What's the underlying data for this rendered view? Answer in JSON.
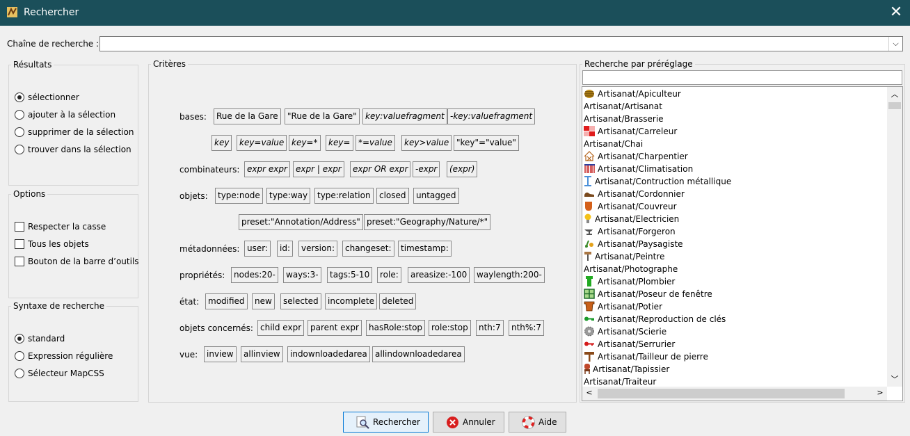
{
  "window": {
    "title": "Rechercher"
  },
  "search": {
    "label": "Chaîne de recherche :",
    "value": "",
    "placeholder": ""
  },
  "results": {
    "title": "Résultats",
    "options": [
      {
        "label": "sélectionner",
        "selected": true
      },
      {
        "label": "ajouter à la sélection",
        "selected": false
      },
      {
        "label": "supprimer de la sélection",
        "selected": false
      },
      {
        "label": "trouver dans la sélection",
        "selected": false
      }
    ]
  },
  "options": {
    "title": "Options",
    "checks": [
      {
        "label": "Respecter la casse",
        "checked": false
      },
      {
        "label": "Tous les objets",
        "checked": false
      },
      {
        "label": "Bouton de la barre d’outils",
        "checked": false
      }
    ]
  },
  "syntax": {
    "title": "Syntaxe de recherche",
    "options": [
      {
        "label": "standard",
        "selected": true
      },
      {
        "label": "Expression régulière",
        "selected": false
      },
      {
        "label": "Sélecteur MapCSS",
        "selected": false
      }
    ]
  },
  "criteria": {
    "title": "Critères",
    "rows": [
      {
        "label": "bases:",
        "tokens": [
          "Rue de la Gare",
          "\"Rue de la Gare\"",
          "key:valuefragment",
          "-key:valuefragment"
        ]
      },
      {
        "label": "",
        "tokens": [
          "key",
          "key=value",
          "key=*",
          "key=",
          "*=value",
          "key>value",
          "\"key\"=\"value\""
        ]
      },
      {
        "label": "combinateurs:",
        "tokens": [
          "expr expr",
          "expr | expr",
          "expr OR expr",
          "-expr",
          "(expr)"
        ]
      },
      {
        "label": "objets:",
        "tokens": [
          "type:node",
          "type:way",
          "type:relation",
          "closed",
          "untagged"
        ]
      },
      {
        "label": "",
        "tokens": [
          "preset:\"Annotation/Address\"",
          "preset:\"Geography/Nature/*\""
        ]
      },
      {
        "label": "métadonnées:",
        "tokens": [
          "user:",
          "id:",
          "version:",
          "changeset:",
          "timestamp:"
        ]
      },
      {
        "label": "propriétés:",
        "tokens": [
          "nodes:20-",
          "ways:3-",
          "tags:5-10",
          "role:",
          "areasize:-100",
          "waylength:200-"
        ]
      },
      {
        "label": "état:",
        "tokens": [
          "modified",
          "new",
          "selected",
          "incomplete",
          "deleted"
        ]
      },
      {
        "label": "objets concernés:",
        "tokens": [
          "child expr",
          "parent expr",
          "hasRole:stop",
          "role:stop",
          "nth:7",
          "nth%:7"
        ]
      },
      {
        "label": "vue:",
        "tokens": [
          "inview",
          "allinview",
          "indownloadedarea",
          "allindownloadedarea"
        ]
      }
    ]
  },
  "presets": {
    "title": "Recherche par préréglage",
    "filter_value": "",
    "items": [
      {
        "label": "Artisanat/Apiculteur",
        "icon": "beehive-icon"
      },
      {
        "label": "Artisanat/Artisanat",
        "icon": ""
      },
      {
        "label": "Artisanat/Brasserie",
        "icon": ""
      },
      {
        "label": "Artisanat/Carreleur",
        "icon": "tiles-icon"
      },
      {
        "label": "Artisanat/Chai",
        "icon": ""
      },
      {
        "label": "Artisanat/Charpentier",
        "icon": "house-frame-icon"
      },
      {
        "label": "Artisanat/Climatisation",
        "icon": "radiator-icon"
      },
      {
        "label": "Artisanat/Contruction métallique",
        "icon": "i-beam-icon"
      },
      {
        "label": "Artisanat/Cordonnier",
        "icon": "shoe-icon"
      },
      {
        "label": "Artisanat/Couvreur",
        "icon": "roof-tile-icon"
      },
      {
        "label": "Artisanat/Electricien",
        "icon": "lightbulb-icon"
      },
      {
        "label": "Artisanat/Forgeron",
        "icon": "anvil-icon"
      },
      {
        "label": "Artisanat/Paysagiste",
        "icon": "garden-icon"
      },
      {
        "label": "Artisanat/Peintre",
        "icon": "paint-roller-icon"
      },
      {
        "label": "Artisanat/Photographe",
        "icon": ""
      },
      {
        "label": "Artisanat/Plombier",
        "icon": "pipe-icon"
      },
      {
        "label": "Artisanat/Poseur de fenêtre",
        "icon": "window-icon"
      },
      {
        "label": "Artisanat/Potier",
        "icon": "flowerpot-icon"
      },
      {
        "label": "Artisanat/Reproduction de clés",
        "icon": "key-icon"
      },
      {
        "label": "Artisanat/Scierie",
        "icon": "saw-blade-icon"
      },
      {
        "label": "Artisanat/Serrurier",
        "icon": "lock-key-icon"
      },
      {
        "label": "Artisanat/Tailleur de pierre",
        "icon": "hammer-icon"
      },
      {
        "label": "Artisanat/Tapissier",
        "icon": "chair-icon"
      },
      {
        "label": "Artisanat/Traiteur",
        "icon": ""
      }
    ]
  },
  "buttons": {
    "search": "Rechercher",
    "cancel": "Annuler",
    "help": "Aide"
  }
}
